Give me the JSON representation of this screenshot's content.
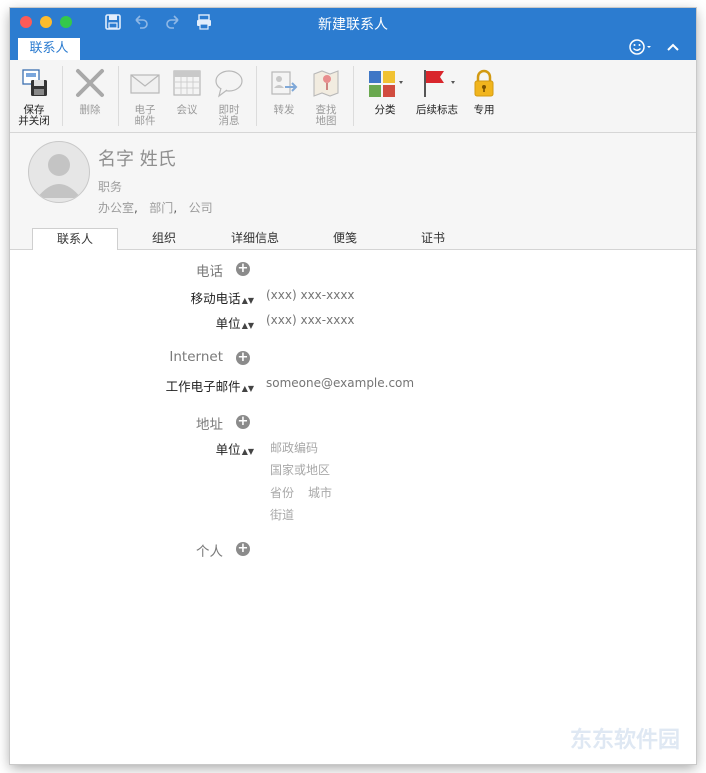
{
  "window": {
    "title": "新建联系人",
    "ribbon_tab": "联系人"
  },
  "toolbar": {
    "items": [
      {
        "label1": "保存",
        "label2": "并关闭",
        "icon": "save-close-icon"
      },
      {
        "label1": "删除",
        "label2": "",
        "icon": "delete-icon"
      },
      {
        "label1": "电子",
        "label2": "邮件",
        "icon": "email-icon"
      },
      {
        "label1": "会议",
        "label2": "",
        "icon": "meeting-icon"
      },
      {
        "label1": "即时",
        "label2": "消息",
        "icon": "instant-message-icon"
      },
      {
        "label1": "转发",
        "label2": "",
        "icon": "forward-icon"
      },
      {
        "label1": "查找",
        "label2": "地图",
        "icon": "map-icon"
      },
      {
        "label1": "分类",
        "label2": "",
        "icon": "categorize-icon"
      },
      {
        "label1": "后续标志",
        "label2": "",
        "icon": "follow-up-flag-icon"
      },
      {
        "label1": "专用",
        "label2": "",
        "icon": "private-lock-icon"
      }
    ]
  },
  "header": {
    "name_placeholder": "名字  姓氏",
    "job_placeholder": "职务",
    "office": "办公室",
    "department": "部门",
    "company": "公司",
    "sep": ","
  },
  "tabs": [
    "联系人",
    "组织",
    "详细信息",
    "便笺",
    "证书"
  ],
  "sections": {
    "phone": {
      "title": "电话",
      "fields": [
        {
          "label": "移动电话",
          "placeholder": "(xxx) xxx-xxxx"
        },
        {
          "label": "单位",
          "placeholder": "(xxx) xxx-xxxx"
        }
      ]
    },
    "internet": {
      "title": "Internet",
      "fields": [
        {
          "label": "工作电子邮件",
          "placeholder": "someone@example.com"
        }
      ]
    },
    "address": {
      "title": "地址",
      "label": "单位",
      "postal": "邮政编码",
      "country": "国家或地区",
      "province": "省份",
      "city": "城市",
      "street": "街道"
    },
    "personal": {
      "title": "个人"
    }
  },
  "watermark": "东东软件园",
  "colors": {
    "titlebar": "#2c7cd0",
    "flag": "#d9262c",
    "lock": "#f1b51d"
  }
}
